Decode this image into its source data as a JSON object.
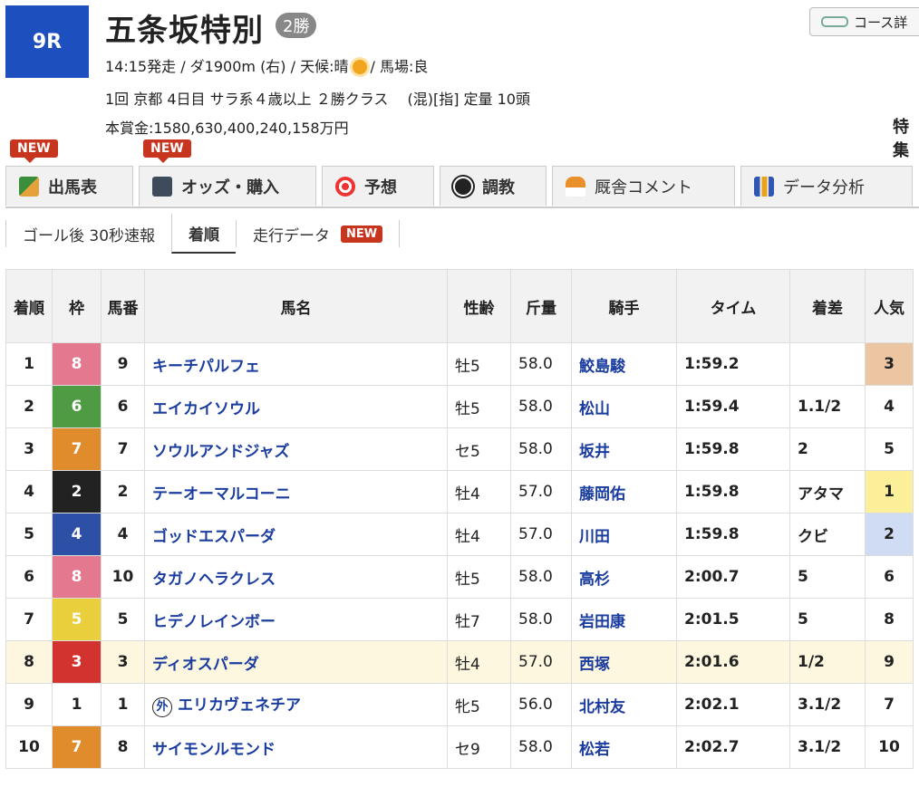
{
  "race": {
    "number": "9R",
    "title": "五条坂特別",
    "grade": "2勝",
    "line1a": "14:15発走 / ダ1900m (右) / 天候:晴",
    "line1b": "/ 馬場:良",
    "line2": "1回 京都 4日目 サラ系４歳以上 ２勝クラス　 (混)[指] 定量 10頭",
    "line3": "本賞金:1580,630,400,240,158万円",
    "course_button": "コース詳",
    "tokushu": "特集"
  },
  "tabs": [
    {
      "label": "出馬表",
      "new": false
    },
    {
      "label": "オッズ・購入",
      "new": true
    },
    {
      "label": "予想",
      "new": false
    },
    {
      "label": "調教",
      "new": false
    },
    {
      "label": "厩舎コメント",
      "new": false
    },
    {
      "label": "データ分析",
      "new": false
    }
  ],
  "new_label": "NEW",
  "subtabs": [
    {
      "label": "ゴール後 30秒速報"
    },
    {
      "label": "着順"
    },
    {
      "label": "走行データ"
    }
  ],
  "table": {
    "headers": [
      "着順",
      "枠",
      "馬番",
      "馬名",
      "性齢",
      "斤量",
      "騎手",
      "タイム",
      "着差",
      "人気"
    ],
    "rows": [
      {
        "rank": "1",
        "waku": "8",
        "umaban": "9",
        "name": "キーチパルフェ",
        "sexage": "牡5",
        "weight": "58.0",
        "jockey": "鮫島駿",
        "time": "1:59.2",
        "margin": "",
        "pop": "3"
      },
      {
        "rank": "2",
        "waku": "6",
        "umaban": "6",
        "name": "エイカイソウル",
        "sexage": "牡5",
        "weight": "58.0",
        "jockey": "松山",
        "time": "1:59.4",
        "margin": "1.1/2",
        "pop": "4"
      },
      {
        "rank": "3",
        "waku": "7",
        "umaban": "7",
        "name": "ソウルアンドジャズ",
        "sexage": "セ5",
        "weight": "58.0",
        "jockey": "坂井",
        "time": "1:59.8",
        "margin": "2",
        "pop": "5"
      },
      {
        "rank": "4",
        "waku": "2",
        "umaban": "2",
        "name": "テーオーマルコーニ",
        "sexage": "牡4",
        "weight": "57.0",
        "jockey": "藤岡佑",
        "time": "1:59.8",
        "margin": "アタマ",
        "pop": "1"
      },
      {
        "rank": "5",
        "waku": "4",
        "umaban": "4",
        "name": "ゴッドエスパーダ",
        "sexage": "牡4",
        "weight": "57.0",
        "jockey": "川田",
        "time": "1:59.8",
        "margin": "クビ",
        "pop": "2"
      },
      {
        "rank": "6",
        "waku": "8",
        "umaban": "10",
        "name": "タガノヘラクレス",
        "sexage": "牡5",
        "weight": "58.0",
        "jockey": "高杉",
        "time": "2:00.7",
        "margin": "5",
        "pop": "6"
      },
      {
        "rank": "7",
        "waku": "5",
        "umaban": "5",
        "name": "ヒデノレインボー",
        "sexage": "牡7",
        "weight": "58.0",
        "jockey": "岩田康",
        "time": "2:01.5",
        "margin": "5",
        "pop": "8"
      },
      {
        "rank": "8",
        "waku": "3",
        "umaban": "3",
        "name": "ディオスパーダ",
        "sexage": "牡4",
        "weight": "57.0",
        "jockey": "西塚",
        "time": "2:01.6",
        "margin": "1/2",
        "pop": "9"
      },
      {
        "rank": "9",
        "waku": "1",
        "umaban": "1",
        "name": "エリカヴェネチア",
        "sexage": "牝5",
        "weight": "56.0",
        "jockey": "北村友",
        "time": "2:02.1",
        "margin": "3.1/2",
        "pop": "7",
        "gai": "外"
      },
      {
        "rank": "10",
        "waku": "7",
        "umaban": "8",
        "name": "サイモンルモンド",
        "sexage": "セ9",
        "weight": "58.0",
        "jockey": "松若",
        "time": "2:02.7",
        "margin": "3.1/2",
        "pop": "10"
      }
    ]
  },
  "waku_colors": {
    "1": "#ffffff",
    "2": "#222222",
    "3": "#d2332f",
    "4": "#2d4fa6",
    "5": "#e9cf3c",
    "6": "#4e9b44",
    "7": "#e08b2c",
    "8": "#e3788f"
  },
  "pop_colors": {
    "1": "#fbef9a",
    "2": "#cfdcf3",
    "3": "#ecc6a3"
  }
}
